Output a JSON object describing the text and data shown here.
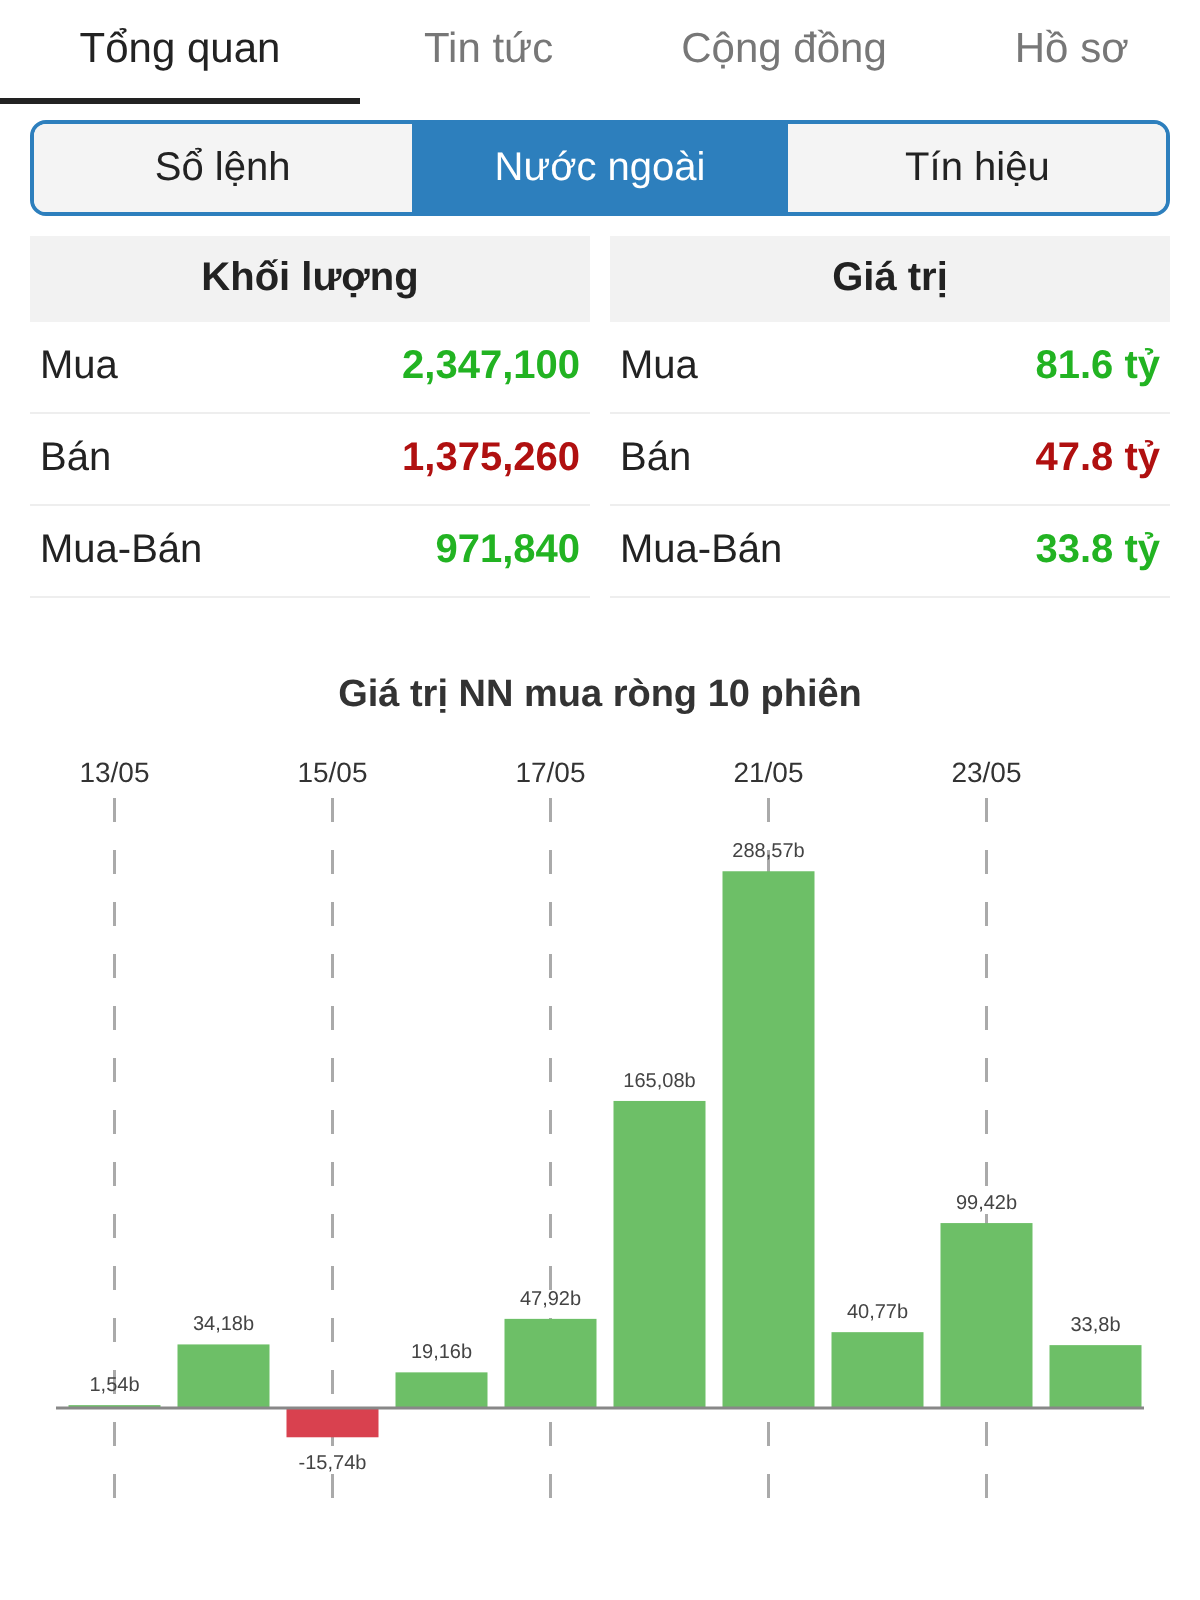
{
  "tabs": [
    {
      "label": "Tổng quan",
      "selected": true
    },
    {
      "label": "Tin tức",
      "selected": false
    },
    {
      "label": "Cộng đồng",
      "selected": false
    },
    {
      "label": "Hồ sơ",
      "selected": false
    }
  ],
  "segments": [
    {
      "label": "Sổ lệnh",
      "selected": false
    },
    {
      "label": "Nước ngoài",
      "selected": true
    },
    {
      "label": "Tín hiệu",
      "selected": false
    }
  ],
  "tables": [
    {
      "heading": "Khối lượng",
      "rows": [
        {
          "label": "Mua",
          "value": "2,347,100",
          "color": "#22b322"
        },
        {
          "label": "Bán",
          "value": "1,375,260",
          "color": "#b01010"
        },
        {
          "label": "Mua-Bán",
          "value": "971,840",
          "color": "#22b322"
        }
      ]
    },
    {
      "heading": "Giá trị",
      "rows": [
        {
          "label": "Mua",
          "value": "81.6 tỷ",
          "color": "#22b322"
        },
        {
          "label": "Bán",
          "value": "47.8 tỷ",
          "color": "#b01010"
        },
        {
          "label": "Mua-Bán",
          "value": "33.8 tỷ",
          "color": "#22b322"
        }
      ]
    }
  ],
  "chart": {
    "chart_data": {
      "type": "bar",
      "title": "Giá trị NN mua ròng 10 phiên",
      "categories": [
        "13/05",
        null,
        "15/05",
        null,
        "17/05",
        null,
        "21/05",
        null,
        "23/05",
        null
      ],
      "grid": true,
      "series": [
        {
          "color": "#6dbf67",
          "values": [
            1.54,
            34.18,
            null,
            19.16,
            47.92,
            165.08,
            288.57,
            40.77,
            99.42,
            33.8
          ],
          "value_labels": [
            "1,54b",
            "34,18b",
            null,
            "19,16b",
            "47,92b",
            "165,08b",
            "288,57b",
            "40,77b",
            "99,42b",
            "33,8b"
          ]
        },
        {
          "color": "#d9414f",
          "values": [
            null,
            null,
            -15.74,
            null,
            null,
            null,
            null,
            null,
            null,
            null
          ],
          "value_labels": [
            null,
            null,
            "-15,74b",
            null,
            null,
            null,
            null,
            null,
            null,
            null
          ]
        }
      ]
    }
  }
}
